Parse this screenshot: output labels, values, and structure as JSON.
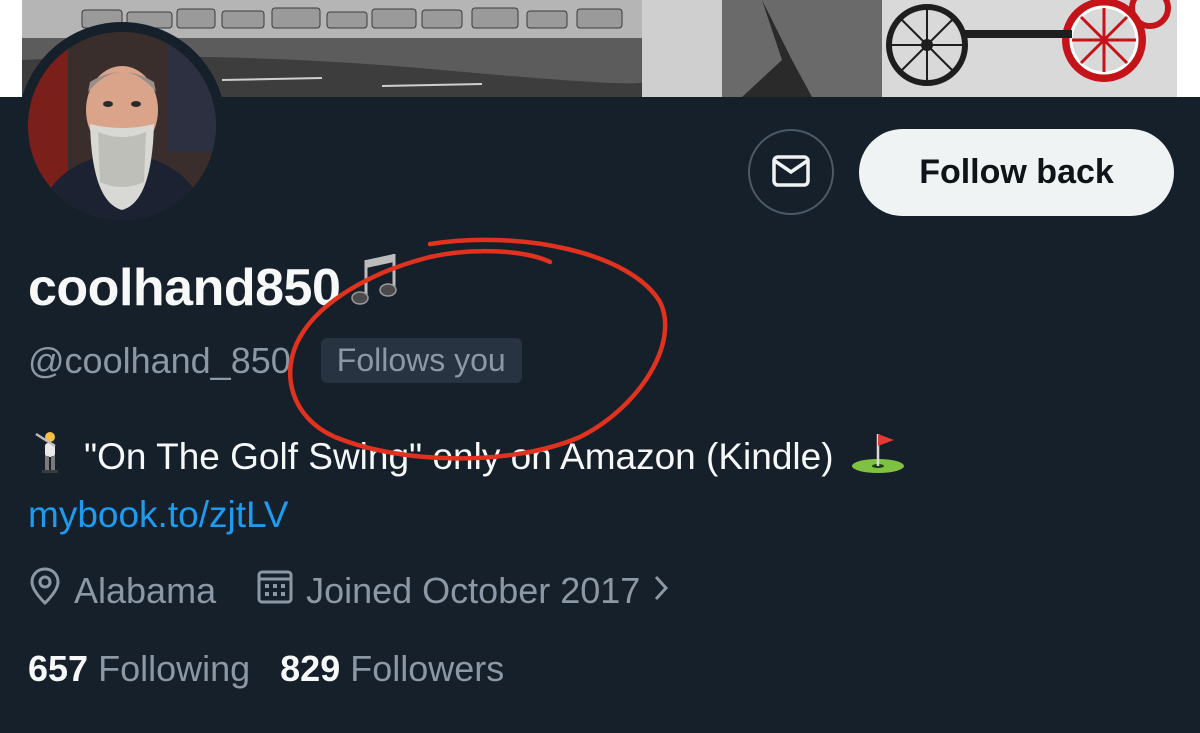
{
  "profile": {
    "display_name": "coolhand850",
    "handle": "@coolhand_850",
    "follows_you_badge": "Follows you",
    "bio_text": "\"On The Golf Swing\" only on Amazon (Kindle)",
    "bio_link": "mybook.to/zjtLV",
    "location": "Alabama",
    "joined": "Joined October 2017"
  },
  "actions": {
    "follow_back_label": "Follow back"
  },
  "stats": {
    "following_count": "657",
    "following_label": "Following",
    "followers_count": "829",
    "followers_label": "Followers"
  },
  "icons": {
    "name_emoji": "music-notes-icon",
    "bio_leading_emoji": "golfer-icon",
    "bio_trailing_emoji": "golf-flag-icon",
    "message": "envelope-icon",
    "location": "location-pin-icon",
    "joined": "calendar-icon"
  },
  "colors": {
    "background": "#15202b",
    "link": "#1d9bf0",
    "secondary_text": "#8b98a5",
    "annotation": "#e0321e"
  }
}
